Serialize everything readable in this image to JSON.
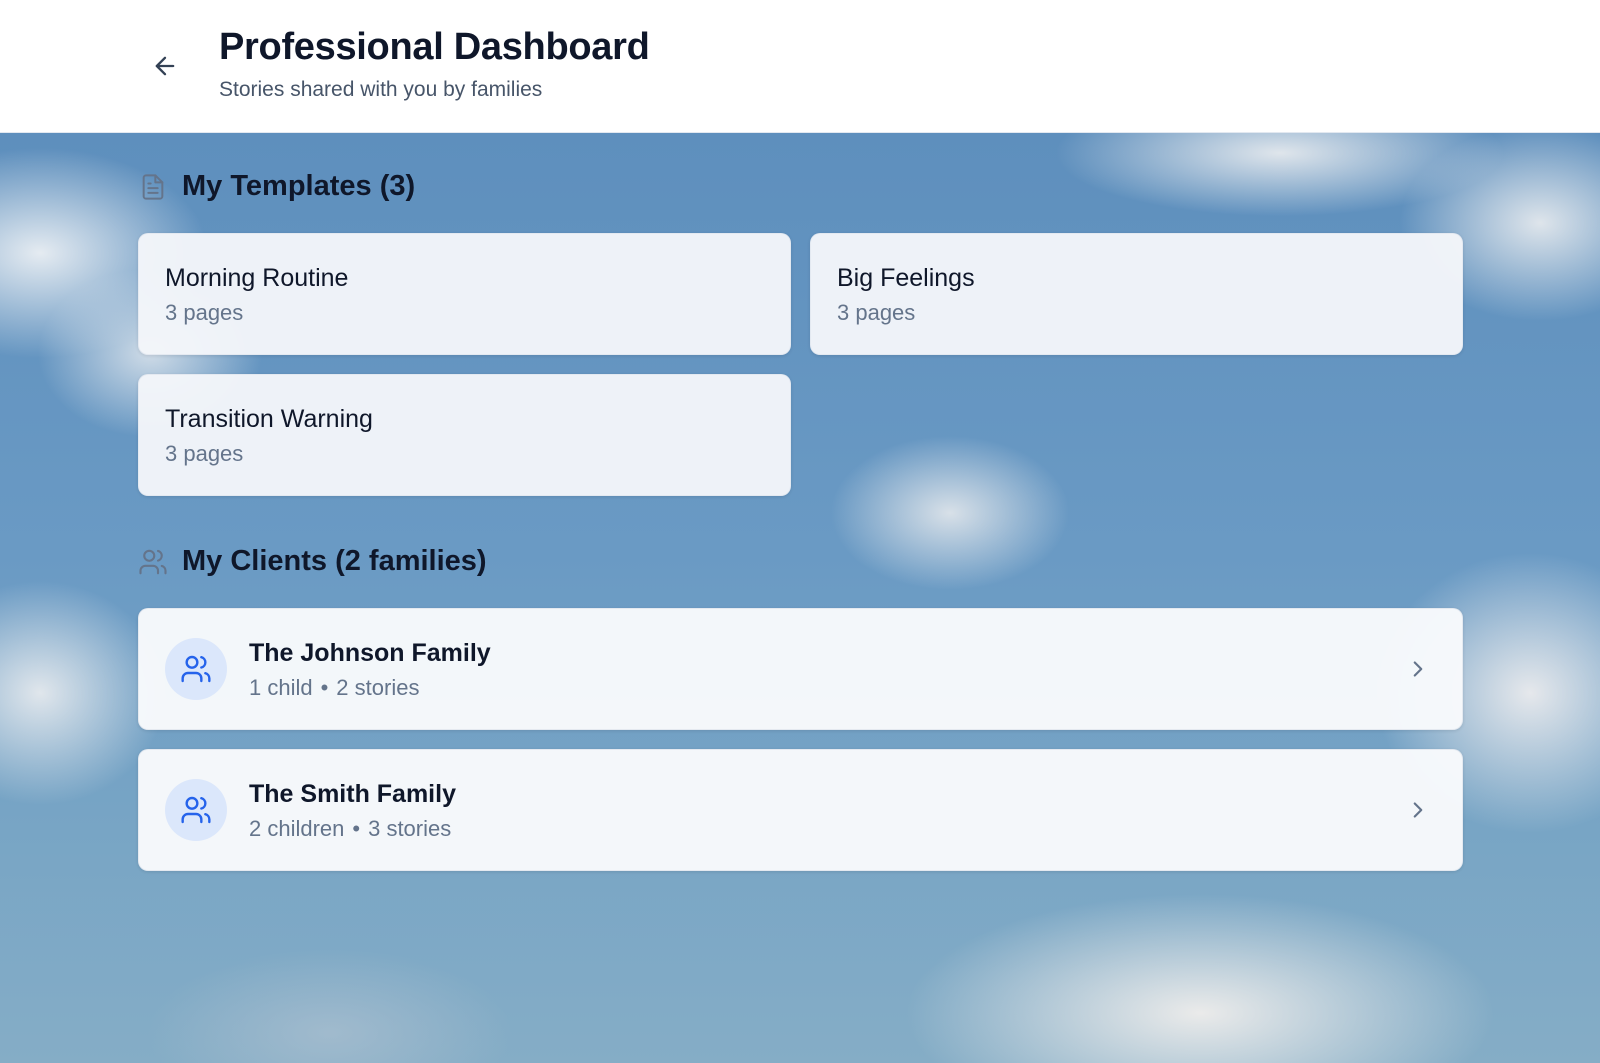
{
  "header": {
    "back_icon": "arrow-left-icon",
    "title": "Professional Dashboard",
    "subtitle": "Stories shared with you by families"
  },
  "templates": {
    "icon": "file-text-icon",
    "title": "My Templates (3)",
    "items": [
      {
        "name": "Morning Routine",
        "pages": "3 pages"
      },
      {
        "name": "Big Feelings",
        "pages": "3 pages"
      },
      {
        "name": "Transition Warning",
        "pages": "3 pages"
      }
    ]
  },
  "clients": {
    "icon": "users-icon",
    "title": "My Clients (2 families)",
    "items": [
      {
        "name": "The Johnson Family",
        "children": "1 child",
        "separator": "•",
        "stories": "2 stories",
        "icon": "users-icon",
        "chevron": "chevron-right-icon"
      },
      {
        "name": "The Smith Family",
        "children": "2 children",
        "separator": "•",
        "stories": "3 stories",
        "icon": "users-icon",
        "chevron": "chevron-right-icon"
      }
    ]
  },
  "colors": {
    "accent": "#2563eb",
    "avatar_bg": "#dbe7fb",
    "text_primary": "#0f172a",
    "text_muted": "#64748b"
  }
}
